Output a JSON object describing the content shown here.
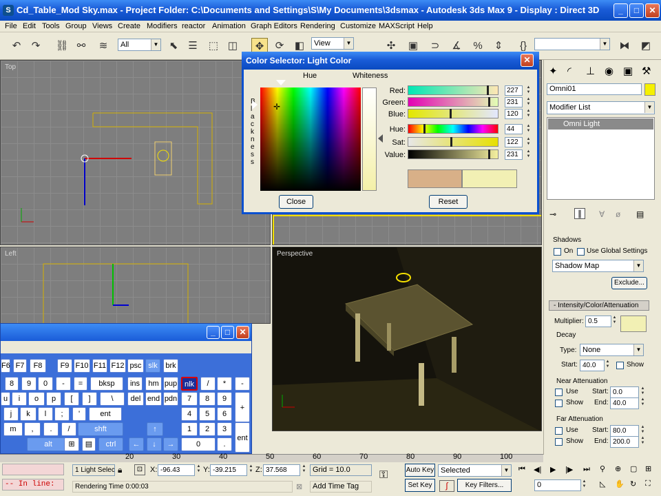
{
  "window": {
    "title": "Cd_Table_Mod Sky.max   - Project Folder: C:\\Documents and Settings\\S\\My Documents\\3dsmax   - Autodesk 3ds Max 9    - Display : Direct 3D",
    "min": "_",
    "max": "□",
    "close": "✕"
  },
  "menu": [
    "File",
    "Edit",
    "Tools",
    "Group",
    "Views",
    "Create",
    "Modifiers",
    "reactor",
    "Animation",
    "Graph Editors",
    "Rendering",
    "Customize",
    "MAXScript",
    "Help"
  ],
  "toolbar": {
    "selection_filter": "All",
    "ref_coord": "View"
  },
  "viewports": {
    "top": "Top",
    "left": "Left",
    "perspective": "Perspective"
  },
  "color_dialog": {
    "title": "Color Selector: Light Color",
    "hue_label": "Hue",
    "whiteness_label": "Whiteness",
    "blackness_label": "B\nl\na\nc\nk\nn\ne\ns\ns",
    "close_button": "Close",
    "reset_button": "Reset",
    "channels": [
      {
        "label": "Red:",
        "value": "227",
        "fraction": 0.89
      },
      {
        "label": "Green:",
        "value": "231",
        "fraction": 0.906
      },
      {
        "label": "Blue:",
        "value": "120",
        "fraction": 0.47
      },
      {
        "label": "Hue:",
        "value": "44",
        "fraction": 0.17
      },
      {
        "label": "Sat:",
        "value": "122",
        "fraction": 0.48
      },
      {
        "label": "Value:",
        "value": "231",
        "fraction": 0.906
      }
    ],
    "old_color": "#d8b088",
    "new_color": "#f2f0b4"
  },
  "command_panel": {
    "object_name": "Omni01",
    "object_color": "#f5f000",
    "modifier_list": "Modifier List",
    "stack_item": "Omni Light"
  },
  "shadows": {
    "header": "Shadows",
    "on": "On",
    "use_global": "Use Global Settings",
    "type": "Shadow Map",
    "exclude": "Exclude..."
  },
  "intensity": {
    "header": "- Intensity/Color/Attenuation",
    "multiplier_label": "Multiplier:",
    "multiplier": "0.5",
    "multiplier_color": "#f2f0b4",
    "decay": {
      "header": "Decay",
      "type_label": "Type:",
      "type": "None",
      "start_label": "Start:",
      "start": "40.0",
      "show": "Show"
    },
    "near": {
      "header": "Near Attenuation",
      "use": "Use",
      "show": "Show",
      "start_label": "Start:",
      "start": "0.0",
      "end_label": "End:",
      "end": "40.0"
    },
    "far": {
      "header": "Far Attenuation",
      "use": "Use",
      "show": "Show",
      "start_label": "Start:",
      "start": "80.0",
      "end_label": "End:",
      "end": "200.0"
    }
  },
  "keyboard": {
    "rows": [
      [
        "F6",
        "F7",
        "F8",
        "F9",
        "F10",
        "F11",
        "F12",
        "psc",
        "slk",
        "brk"
      ],
      [
        "8",
        "9",
        "0",
        "-",
        "=",
        "bksp",
        "ins",
        "hm",
        "pup",
        "nlk",
        "/",
        "*",
        "-"
      ],
      [
        "u",
        "i",
        "o",
        "p",
        "[",
        "]",
        "\\",
        "del",
        "end",
        "pdn",
        "7",
        "8",
        "9",
        "+"
      ],
      [
        "j",
        "k",
        "l",
        ";",
        "'",
        "ent",
        "4",
        "5",
        "6"
      ],
      [
        "m",
        ",",
        ".",
        "/",
        "shft",
        "↑",
        "1",
        "2",
        "3",
        "ent"
      ],
      [
        "alt",
        "ctrl",
        "←",
        "↓",
        "→",
        "0",
        "."
      ]
    ]
  },
  "timeline": {
    "ticks": [
      "20",
      "30",
      "40",
      "50",
      "60",
      "70",
      "80",
      "90",
      "100"
    ]
  },
  "status": {
    "selection": "1 Light Selec",
    "x_label": "X:",
    "x": "-96.43",
    "y_label": "Y:",
    "y": "-39.215",
    "z_label": "Z:",
    "z": "37.568",
    "grid": "Grid = 10.0",
    "autokey": "Auto Key",
    "selected": "Selected",
    "setkey": "Set Key",
    "keyfilters": "Key Filters...",
    "frame": "0",
    "maxscript": "-- In line:",
    "rendering_time": "Rendering Time  0:00:03",
    "add_time_tag": "Add Time Tag"
  }
}
